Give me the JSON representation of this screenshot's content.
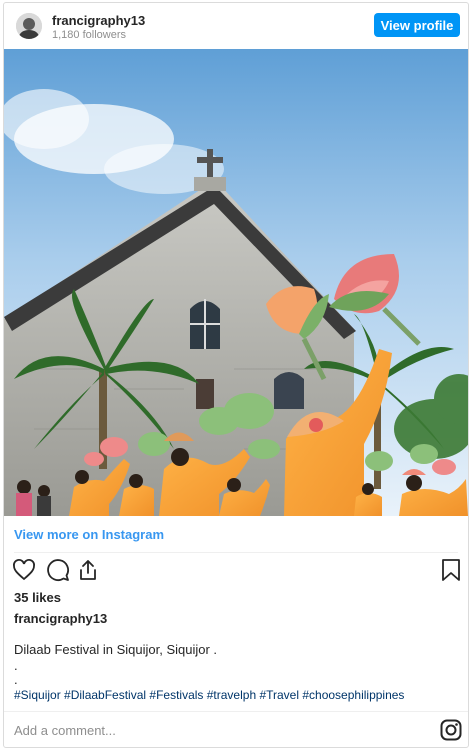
{
  "header": {
    "username": "francigraphy13",
    "followers": "1,180 followers",
    "view_profile_label": "View profile"
  },
  "post": {
    "view_more_label": "View more on Instagram",
    "likes": "35 likes",
    "author": "francigraphy13",
    "caption": "Dilaab Festival in Siquijor, Siquijor .",
    "dot1": ".",
    "dot2": ".",
    "hashtags": "#Siquijor #DilaabFestival #Festivals #travelph #Travel #choosephilippines"
  },
  "comment": {
    "placeholder": "Add a comment..."
  },
  "colors": {
    "accent": "#0095f6",
    "link": "#3897f0",
    "hashtag": "#003569"
  },
  "icons": [
    "heart-icon",
    "comment-icon",
    "share-icon",
    "bookmark-icon",
    "instagram-icon"
  ]
}
